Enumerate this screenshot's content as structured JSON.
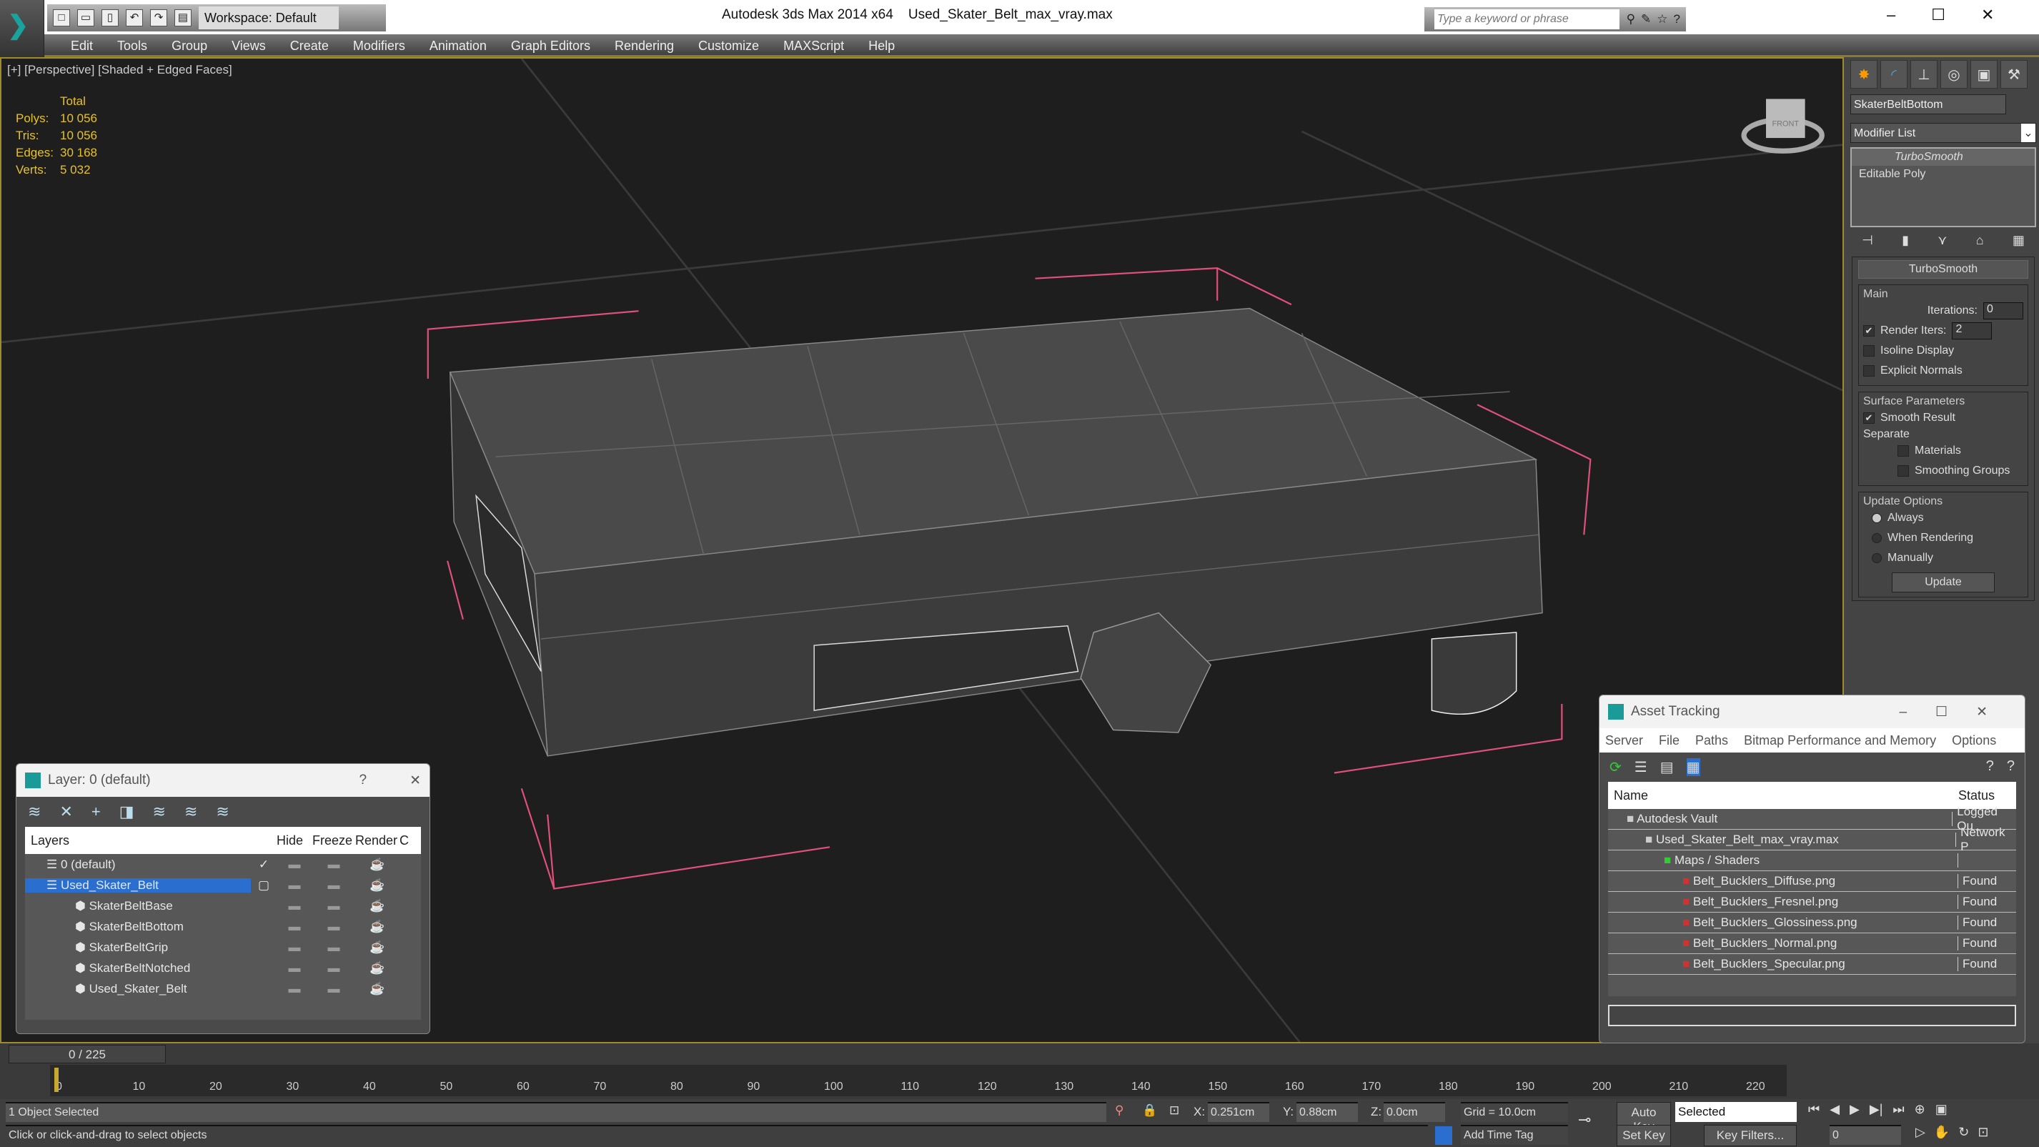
{
  "titlebar": {
    "workspace": "Workspace: Default",
    "app": "Autodesk 3ds Max  2014 x64",
    "file": "Used_Skater_Belt_max_vray.max",
    "search_placeholder": "Type a keyword or phrase"
  },
  "menu": [
    "Edit",
    "Tools",
    "Group",
    "Views",
    "Create",
    "Modifiers",
    "Animation",
    "Graph Editors",
    "Rendering",
    "Customize",
    "MAXScript",
    "Help"
  ],
  "viewport": {
    "label": "[+] [Perspective] [Shaded + Edged Faces]",
    "stats_title": "Total",
    "stats": [
      {
        "k": "Polys:",
        "v": "10 056"
      },
      {
        "k": "Tris:",
        "v": "10 056"
      },
      {
        "k": "Edges:",
        "v": "30 168"
      },
      {
        "k": "Verts:",
        "v": "5 032"
      }
    ],
    "viewcube_label": "FRONT",
    "bbox_color": "#e0507a"
  },
  "command_panel": {
    "object_name": "SkaterBeltBottom",
    "modifier_list": "Modifier List",
    "stack": [
      "TurboSmooth",
      "Editable Poly"
    ],
    "rollout": "TurboSmooth",
    "main": "Main",
    "iterations_label": "Iterations:",
    "iterations": "0",
    "render_iters_label": "Render Iters:",
    "render_iters": "2",
    "render_iters_checked": true,
    "isoline": "Isoline Display",
    "explicit_normals": "Explicit Normals",
    "surface": "Surface Parameters",
    "smooth_result": "Smooth Result",
    "separate": "Separate",
    "materials": "Materials",
    "smoothing_groups": "Smoothing Groups",
    "update_options": "Update Options",
    "always": "Always",
    "when_rendering": "When Rendering",
    "manually": "Manually",
    "update": "Update",
    "selected_update": "Always"
  },
  "layer_dialog": {
    "title": "Layer: 0 (default)",
    "help": "?",
    "columns": [
      "Layers",
      "",
      "Hide",
      "Freeze",
      "Render",
      "C"
    ],
    "rows": [
      {
        "name": "0 (default)",
        "level": 0,
        "current": true
      },
      {
        "name": "Used_Skater_Belt",
        "level": 0,
        "selected": true
      },
      {
        "name": "SkaterBeltBase",
        "level": 1
      },
      {
        "name": "SkaterBeltBottom",
        "level": 1
      },
      {
        "name": "SkaterBeltGrip",
        "level": 1
      },
      {
        "name": "SkaterBeltNotched",
        "level": 1
      },
      {
        "name": "Used_Skater_Belt",
        "level": 1
      }
    ]
  },
  "asset_dialog": {
    "title": "Asset Tracking",
    "menu": [
      "Server",
      "File",
      "Paths",
      "Bitmap Performance and Memory",
      "Options"
    ],
    "columns": [
      "Name",
      "Status"
    ],
    "rows": [
      {
        "name": "Autodesk Vault",
        "status": "Logged Ou",
        "level": 1
      },
      {
        "name": "Used_Skater_Belt_max_vray.max",
        "status": "Network P",
        "level": 2
      },
      {
        "name": "Maps / Shaders",
        "status": "",
        "level": 3
      },
      {
        "name": "Belt_Bucklers_Diffuse.png",
        "status": "Found",
        "level": 4
      },
      {
        "name": "Belt_Bucklers_Fresnel.png",
        "status": "Found",
        "level": 4
      },
      {
        "name": "Belt_Bucklers_Glossiness.png",
        "status": "Found",
        "level": 4
      },
      {
        "name": "Belt_Bucklers_Normal.png",
        "status": "Found",
        "level": 4
      },
      {
        "name": "Belt_Bucklers_Specular.png",
        "status": "Found",
        "level": 4
      }
    ]
  },
  "timeline": {
    "frame": "0 / 225",
    "ticks": [
      "0",
      "10",
      "20",
      "30",
      "40",
      "50",
      "60",
      "70",
      "80",
      "90",
      "100",
      "110",
      "120",
      "130",
      "140",
      "150",
      "160",
      "170",
      "180",
      "190",
      "200",
      "210",
      "220"
    ]
  },
  "status": {
    "selection": "1 Object Selected",
    "prompt": "Click or click-and-drag to select objects",
    "x": "0.251cm",
    "y": "0.88cm",
    "z": "0.0cm",
    "grid": "Grid = 10.0cm",
    "add_time_tag": "Add Time Tag",
    "auto_key": "Auto Key",
    "set_key": "Set Key",
    "key_mode": "Selected",
    "key_filters": "Key Filters...",
    "frame_field": "0"
  }
}
